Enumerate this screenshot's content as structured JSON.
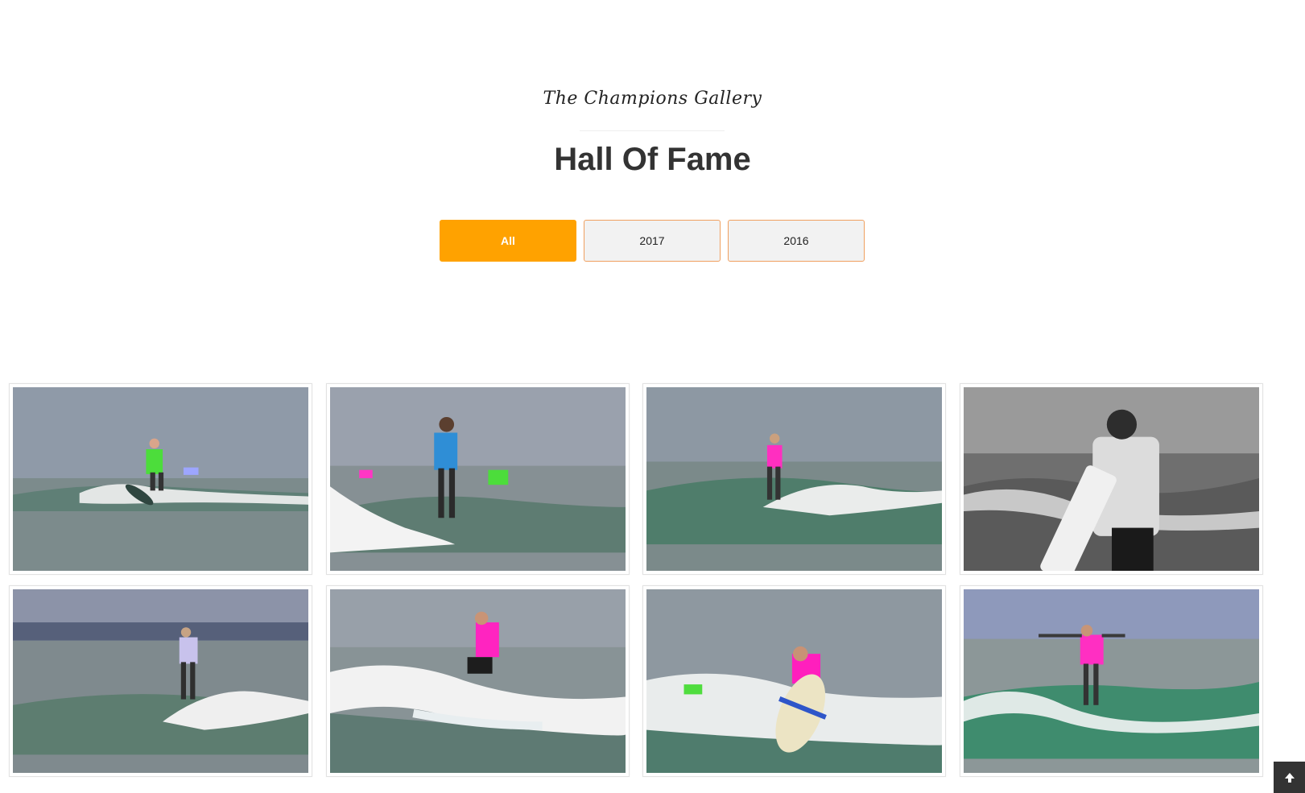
{
  "header": {
    "subtitle": "The Champions Gallery",
    "title": "Hall Of Fame"
  },
  "filters": [
    {
      "label": "All",
      "active": true
    },
    {
      "label": "2017",
      "active": false
    },
    {
      "label": "2016",
      "active": false
    }
  ],
  "colors": {
    "accent": "#ffa200",
    "filter_border": "#f0a060",
    "filter_bg": "#f2f2f2",
    "title_text": "#333333"
  },
  "gallery": {
    "items": [
      {
        "name": "surfer-green-shirt"
      },
      {
        "name": "surfer-blue-shirt"
      },
      {
        "name": "surfer-pink-shirt-small"
      },
      {
        "name": "surfer-walking-bw"
      },
      {
        "name": "surfer-lavender-shirt"
      },
      {
        "name": "surfer-pink-shirt-carving"
      },
      {
        "name": "surfer-pink-shirt-board-up"
      },
      {
        "name": "surfer-pink-shirt-arms-out"
      }
    ]
  },
  "scroll_top": {
    "icon": "arrow-up-icon"
  }
}
